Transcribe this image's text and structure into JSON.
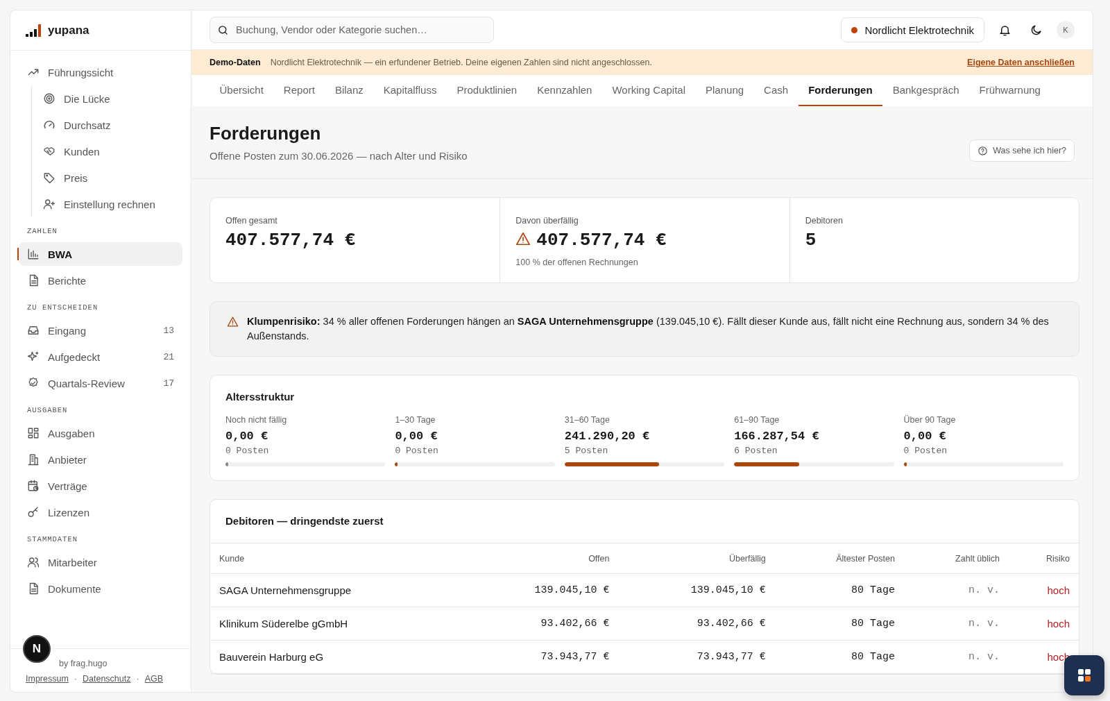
{
  "sidebar": {
    "logo": "yupana",
    "groups": [
      {
        "items": [
          {
            "label": "Führungssicht",
            "selected": false,
            "children": [
              {
                "label": "Die Lücke",
                "selected": false
              },
              {
                "label": "Durchsatz",
                "selected": false
              },
              {
                "label": "Kunden",
                "selected": false
              },
              {
                "label": "Preis",
                "selected": false
              },
              {
                "label": "Einstellung rechnen",
                "selected": false
              }
            ]
          }
        ]
      },
      {
        "label": "ZAHLEN",
        "items": [
          {
            "label": "BWA",
            "selected": true
          },
          {
            "label": "Berichte",
            "selected": false
          }
        ]
      },
      {
        "label": "ZU ENTSCHEIDEN",
        "items": [
          {
            "label": "Eingang",
            "selected": false,
            "count": "13"
          },
          {
            "label": "Aufgedeckt",
            "selected": false,
            "count": "21"
          },
          {
            "label": "Quartals-Review",
            "selected": false,
            "count": "17"
          }
        ]
      },
      {
        "label": "AUSGABEN",
        "items": [
          {
            "label": "Ausgaben",
            "selected": false
          },
          {
            "label": "Anbieter",
            "selected": false
          },
          {
            "label": "Verträge",
            "selected": false
          },
          {
            "label": "Lizenzen",
            "selected": false
          }
        ]
      },
      {
        "label": "STAMMDATEN",
        "items": [
          {
            "label": "Mitarbeiter",
            "selected": false
          },
          {
            "label": "Dokumente",
            "selected": false
          }
        ]
      }
    ],
    "footer": {
      "credit": "by frag.hugo",
      "links": [
        "Impressum",
        "Datenschutz",
        "AGB"
      ],
      "separator": "·"
    },
    "dev_badge": "N"
  },
  "topbar": {
    "search": {
      "placeholder": "Buchung, Vendor oder Kategorie suchen…"
    },
    "company": {
      "name": "Nordlicht Elektrotechnik",
      "color": "#c2410c"
    },
    "avatar": "K"
  },
  "banner": {
    "label": "Demo-Daten",
    "text": "Nordlicht Elektrotechnik — ein erfundener Betrieb. Deine eigenen Zahlen sind nicht angeschlossen.",
    "link": "Eigene Daten anschließen"
  },
  "tabs": [
    {
      "label": "Übersicht",
      "selected": false
    },
    {
      "label": "Report",
      "selected": false
    },
    {
      "label": "Bilanz",
      "selected": false
    },
    {
      "label": "Kapitalfluss",
      "selected": false
    },
    {
      "label": "Produktlinien",
      "selected": false
    },
    {
      "label": "Kennzahlen",
      "selected": false
    },
    {
      "label": "Working Capital",
      "selected": false
    },
    {
      "label": "Planung",
      "selected": false
    },
    {
      "label": "Cash",
      "selected": false
    },
    {
      "label": "Forderungen",
      "selected": true
    },
    {
      "label": "Bankgespräch",
      "selected": false
    },
    {
      "label": "Frühwarnung",
      "selected": false
    }
  ],
  "page": {
    "title": "Forderungen",
    "subtitle": "Offene Posten zum 30.06.2026 — nach Alter und Risiko",
    "help_button": "Was sehe ich hier?"
  },
  "kpis": [
    {
      "label": "Offen gesamt",
      "value": "407.577,74 €",
      "warning": false
    },
    {
      "label": "Davon überfällig",
      "value": "407.577,74 €",
      "warning": true,
      "note": "100 % der offenen Rechnungen"
    },
    {
      "label": "Debitoren",
      "value": "5",
      "warning": false
    }
  ],
  "alert": {
    "text": "**Klumpenrisiko:** 34 % aller offenen Forderungen hängen an **SAGA Unternehmensgruppe** (139.045,10 €). Fällt dieser Kunde aus, fällt nicht eine Rechnung aus, sondern 34 % des Außenstands."
  },
  "aging": {
    "title": "Altersstruktur",
    "buckets": [
      {
        "label": "Noch nicht fällig",
        "amount": "0,00 €",
        "count": "0 Posten",
        "level": 0,
        "color": "#8a8a8a"
      },
      {
        "label": "1–30 Tage",
        "amount": "0,00 €",
        "count": "0 Posten",
        "level": 0,
        "color": "#a8470f"
      },
      {
        "label": "31–60 Tage",
        "amount": "241.290,20 €",
        "count": "5 Posten",
        "level": 0.592,
        "color": "#a8470f"
      },
      {
        "label": "61–90 Tage",
        "amount": "166.287,54 €",
        "count": "6 Posten",
        "level": 0.408,
        "color": "#a8470f"
      },
      {
        "label": "Über 90 Tage",
        "amount": "0,00 €",
        "count": "0 Posten",
        "level": 0,
        "color": "#a8470f"
      }
    ]
  },
  "debtors": {
    "title": "Debitoren — dringendste zuerst",
    "columns": [
      "Kunde",
      "Offen",
      "Überfällig",
      "Ältester Posten",
      "Zahlt üblich",
      "Risiko"
    ],
    "rows": [
      {
        "cells": [
          "SAGA Unternehmensgruppe",
          "139.045,10 €",
          "139.045,10 €",
          "80 Tage",
          "n. v.",
          "hoch"
        ]
      },
      {
        "cells": [
          "Klinikum Süderelbe gGmbH",
          "93.402,66 €",
          "93.402,66 €",
          "80 Tage",
          "n. v.",
          "hoch"
        ]
      },
      {
        "cells": [
          "Bauverein Harburg eG",
          "73.943,77 €",
          "73.943,77 €",
          "80 Tage",
          "n. v.",
          "hoch"
        ]
      }
    ]
  }
}
